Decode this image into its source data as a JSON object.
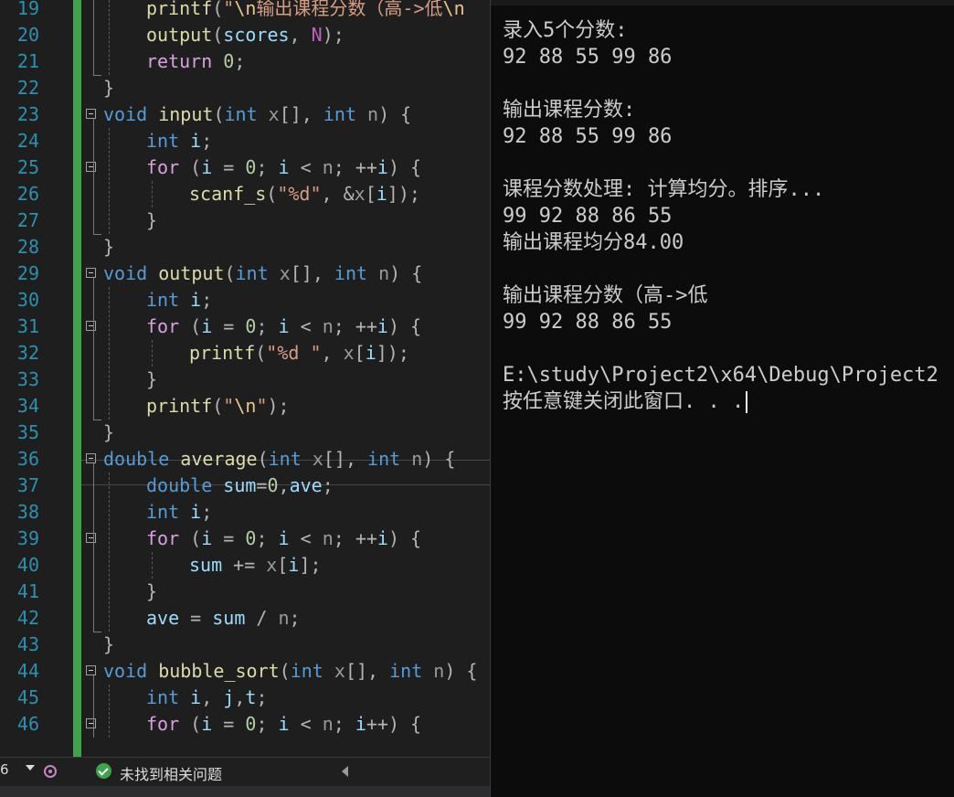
{
  "editor": {
    "lines": [
      {
        "n": "19",
        "parts": [
          [
            "fn",
            "printf"
          ],
          [
            "punc",
            "("
          ],
          [
            "str",
            "\""
          ],
          [
            "esc",
            "\\n"
          ],
          [
            "str",
            "输出课程分数（高->低"
          ],
          [
            "esc",
            "\\n"
          ]
        ]
      },
      {
        "n": "20",
        "parts": [
          [
            "fn",
            "output"
          ],
          [
            "punc",
            "("
          ],
          [
            "var",
            "scores"
          ],
          [
            "punc",
            ", "
          ],
          [
            "mac",
            "N"
          ],
          [
            "punc",
            ");"
          ]
        ]
      },
      {
        "n": "21",
        "parts": [
          [
            "ctl",
            "return"
          ],
          [
            "punc",
            " "
          ],
          [
            "num",
            "0"
          ],
          [
            "punc",
            ";"
          ]
        ]
      },
      {
        "n": "22",
        "parts": [
          [
            "punc",
            "}"
          ]
        ]
      },
      {
        "n": "23",
        "parts": [
          [
            "kw",
            "void"
          ],
          [
            "punc",
            " "
          ],
          [
            "fn",
            "input"
          ],
          [
            "punc",
            "("
          ],
          [
            "kw",
            "int"
          ],
          [
            "punc",
            " "
          ],
          [
            "param",
            "x"
          ],
          [
            "punc",
            "[], "
          ],
          [
            "kw",
            "int"
          ],
          [
            "punc",
            " "
          ],
          [
            "param",
            "n"
          ],
          [
            "punc",
            ") {"
          ]
        ]
      },
      {
        "n": "24",
        "parts": [
          [
            "kw",
            "int"
          ],
          [
            "punc",
            " "
          ],
          [
            "var",
            "i"
          ],
          [
            "punc",
            ";"
          ]
        ]
      },
      {
        "n": "25",
        "parts": [
          [
            "ctl",
            "for"
          ],
          [
            "punc",
            " ("
          ],
          [
            "var",
            "i"
          ],
          [
            "punc",
            " = "
          ],
          [
            "num",
            "0"
          ],
          [
            "punc",
            "; "
          ],
          [
            "var",
            "i"
          ],
          [
            "punc",
            " < "
          ],
          [
            "param",
            "n"
          ],
          [
            "punc",
            "; ++"
          ],
          [
            "var",
            "i"
          ],
          [
            "punc",
            ") {"
          ]
        ]
      },
      {
        "n": "26",
        "parts": [
          [
            "fn",
            "scanf_s"
          ],
          [
            "punc",
            "("
          ],
          [
            "str",
            "\"%d\""
          ],
          [
            "punc",
            ", &"
          ],
          [
            "param",
            "x"
          ],
          [
            "punc",
            "["
          ],
          [
            "var",
            "i"
          ],
          [
            "punc",
            "]);"
          ]
        ]
      },
      {
        "n": "27",
        "parts": [
          [
            "punc",
            "}"
          ]
        ]
      },
      {
        "n": "28",
        "parts": [
          [
            "punc",
            "}"
          ]
        ]
      },
      {
        "n": "29",
        "parts": [
          [
            "kw",
            "void"
          ],
          [
            "punc",
            " "
          ],
          [
            "fn",
            "output"
          ],
          [
            "punc",
            "("
          ],
          [
            "kw",
            "int"
          ],
          [
            "punc",
            " "
          ],
          [
            "param",
            "x"
          ],
          [
            "punc",
            "[], "
          ],
          [
            "kw",
            "int"
          ],
          [
            "punc",
            " "
          ],
          [
            "param",
            "n"
          ],
          [
            "punc",
            ") {"
          ]
        ]
      },
      {
        "n": "30",
        "parts": [
          [
            "kw",
            "int"
          ],
          [
            "punc",
            " "
          ],
          [
            "var",
            "i"
          ],
          [
            "punc",
            ";"
          ]
        ]
      },
      {
        "n": "31",
        "parts": [
          [
            "ctl",
            "for"
          ],
          [
            "punc",
            " ("
          ],
          [
            "var",
            "i"
          ],
          [
            "punc",
            " = "
          ],
          [
            "num",
            "0"
          ],
          [
            "punc",
            "; "
          ],
          [
            "var",
            "i"
          ],
          [
            "punc",
            " < "
          ],
          [
            "param",
            "n"
          ],
          [
            "punc",
            "; ++"
          ],
          [
            "var",
            "i"
          ],
          [
            "punc",
            ") {"
          ]
        ]
      },
      {
        "n": "32",
        "parts": [
          [
            "fn",
            "printf"
          ],
          [
            "punc",
            "("
          ],
          [
            "str",
            "\"%d \""
          ],
          [
            "punc",
            ", "
          ],
          [
            "param",
            "x"
          ],
          [
            "punc",
            "["
          ],
          [
            "var",
            "i"
          ],
          [
            "punc",
            "]);"
          ]
        ]
      },
      {
        "n": "33",
        "parts": [
          [
            "punc",
            "}"
          ]
        ]
      },
      {
        "n": "34",
        "parts": [
          [
            "fn",
            "printf"
          ],
          [
            "punc",
            "("
          ],
          [
            "str",
            "\""
          ],
          [
            "esc",
            "\\n"
          ],
          [
            "str",
            "\""
          ],
          [
            "punc",
            ");"
          ]
        ]
      },
      {
        "n": "35",
        "parts": [
          [
            "punc",
            "}"
          ]
        ]
      },
      {
        "n": "36",
        "parts": [
          [
            "kw",
            "double"
          ],
          [
            "punc",
            " "
          ],
          [
            "fn",
            "average"
          ],
          [
            "punc",
            "("
          ],
          [
            "kw",
            "int"
          ],
          [
            "punc",
            " "
          ],
          [
            "param",
            "x"
          ],
          [
            "punc",
            "[], "
          ],
          [
            "kw",
            "int"
          ],
          [
            "punc",
            " "
          ],
          [
            "param",
            "n"
          ],
          [
            "punc",
            ") {"
          ]
        ]
      },
      {
        "n": "37",
        "parts": [
          [
            "kw",
            "double"
          ],
          [
            "punc",
            " "
          ],
          [
            "var",
            "sum"
          ],
          [
            "punc",
            "="
          ],
          [
            "num",
            "0"
          ],
          [
            "punc",
            ","
          ],
          [
            "var",
            "ave"
          ],
          [
            "punc",
            ";"
          ]
        ]
      },
      {
        "n": "38",
        "parts": [
          [
            "kw",
            "int"
          ],
          [
            "punc",
            " "
          ],
          [
            "var",
            "i"
          ],
          [
            "punc",
            ";"
          ]
        ]
      },
      {
        "n": "39",
        "parts": [
          [
            "ctl",
            "for"
          ],
          [
            "punc",
            " ("
          ],
          [
            "var",
            "i"
          ],
          [
            "punc",
            " = "
          ],
          [
            "num",
            "0"
          ],
          [
            "punc",
            "; "
          ],
          [
            "var",
            "i"
          ],
          [
            "punc",
            " < "
          ],
          [
            "param",
            "n"
          ],
          [
            "punc",
            "; ++"
          ],
          [
            "var",
            "i"
          ],
          [
            "punc",
            ") {"
          ]
        ]
      },
      {
        "n": "40",
        "parts": [
          [
            "var",
            "sum"
          ],
          [
            "punc",
            " += "
          ],
          [
            "param",
            "x"
          ],
          [
            "punc",
            "["
          ],
          [
            "var",
            "i"
          ],
          [
            "punc",
            "];"
          ]
        ]
      },
      {
        "n": "41",
        "parts": [
          [
            "punc",
            "}"
          ]
        ]
      },
      {
        "n": "42",
        "parts": [
          [
            "var",
            "ave"
          ],
          [
            "punc",
            " = "
          ],
          [
            "var",
            "sum"
          ],
          [
            "punc",
            " / "
          ],
          [
            "param",
            "n"
          ],
          [
            "punc",
            ";"
          ]
        ]
      },
      {
        "n": "43",
        "parts": [
          [
            "punc",
            "}"
          ]
        ]
      },
      {
        "n": "44",
        "parts": [
          [
            "kw",
            "void"
          ],
          [
            "punc",
            " "
          ],
          [
            "fn",
            "bubble_sort"
          ],
          [
            "punc",
            "("
          ],
          [
            "kw",
            "int"
          ],
          [
            "punc",
            " "
          ],
          [
            "param",
            "x"
          ],
          [
            "punc",
            "[], "
          ],
          [
            "kw",
            "int"
          ],
          [
            "punc",
            " "
          ],
          [
            "param",
            "n"
          ],
          [
            "punc",
            ") {"
          ]
        ]
      },
      {
        "n": "45",
        "parts": [
          [
            "kw",
            "int"
          ],
          [
            "punc",
            " "
          ],
          [
            "var",
            "i"
          ],
          [
            "punc",
            ", "
          ],
          [
            "var",
            "j"
          ],
          [
            "punc",
            ","
          ],
          [
            "var",
            "t"
          ],
          [
            "punc",
            ";"
          ]
        ]
      },
      {
        "n": "46",
        "parts": [
          [
            "ctl",
            "for"
          ],
          [
            "punc",
            " ("
          ],
          [
            "var",
            "i"
          ],
          [
            "punc",
            " = "
          ],
          [
            "num",
            "0"
          ],
          [
            "punc",
            "; "
          ],
          [
            "var",
            "i"
          ],
          [
            "punc",
            " < "
          ],
          [
            "param",
            "n"
          ],
          [
            "punc",
            "; "
          ],
          [
            "var",
            "i"
          ],
          [
            "punc",
            "++) {"
          ]
        ]
      }
    ]
  },
  "status_bar": {
    "zoom": "6",
    "issues_text": "未找到相关问题"
  },
  "console": {
    "lines": [
      "录入5个分数:",
      "92 88 55 99 86",
      "",
      "输出课程分数:",
      "92 88 55 99 86",
      "",
      "课程分数处理: 计算均分。排序...",
      "99 92 88 86 55",
      "输出课程均分84.00",
      "",
      "输出课程分数（高->低",
      "99 92 88 86 55",
      "",
      "E:\\study\\Project2\\x64\\Debug\\Project2",
      "按任意键关闭此窗口. . ."
    ]
  }
}
